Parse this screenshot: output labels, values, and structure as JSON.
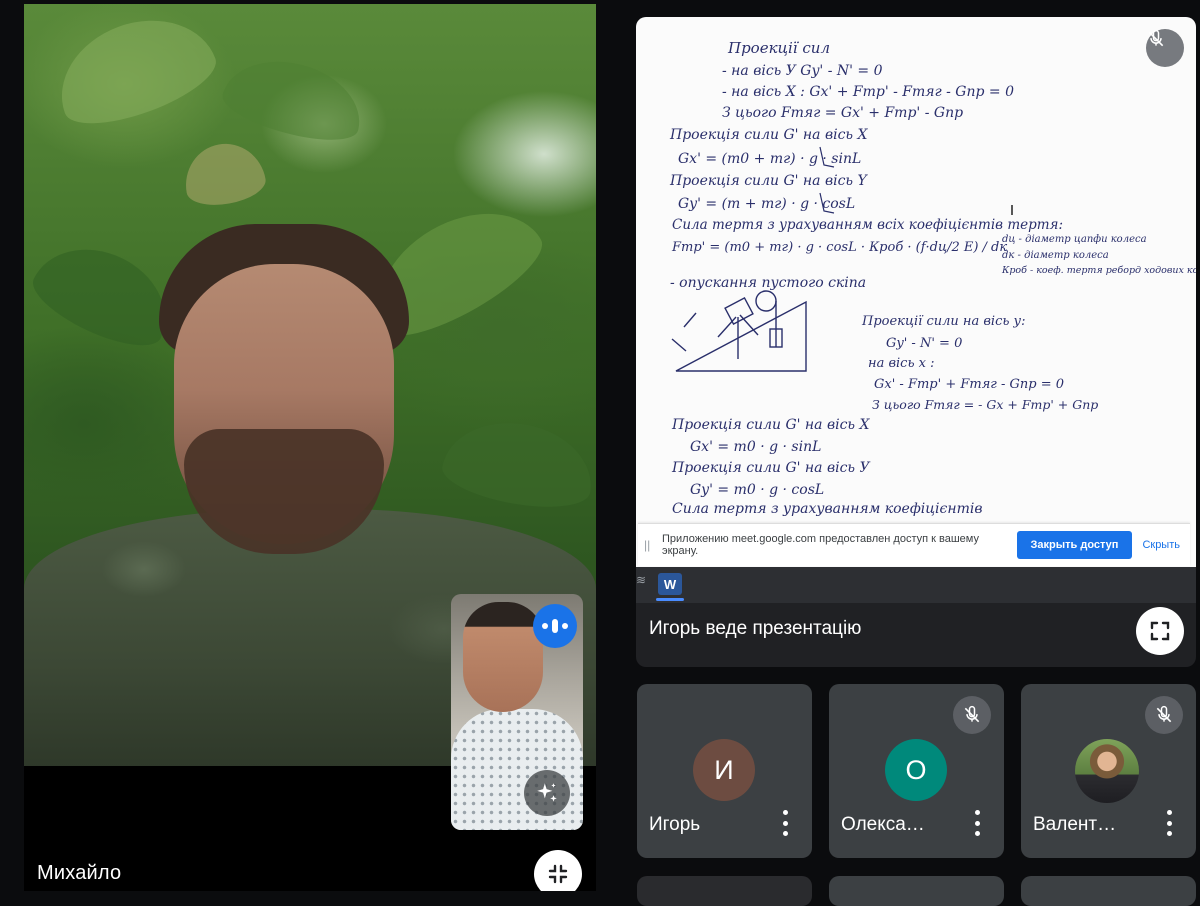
{
  "main_tile": {
    "participant_name": "Михайло"
  },
  "presentation": {
    "presenter_label": "Игорь веде презентацію",
    "share_bar": {
      "message": "Приложению meet.google.com предоставлен доступ к вашему экрану.",
      "stop_button": "Закрыть доступ",
      "hide_link": "Скрыть"
    },
    "taskbar": {
      "word_icon_letter": "W"
    },
    "handwritten_notes": [
      "Проекції сил",
      "- на вісь У   Gy' - N' = 0",
      "- на вісь Х :   Gx' + Fтр' - Fтяг - Gпр = 0",
      "З цього  Fтяг = Gx' + Fтр' - Gпр",
      "Проекція сили G' на вісь X",
      "Gx' = (m0 + mг) · g · sinL",
      "Проекція сили G' на вісь Y",
      "Gy' = (m + mг) · g · cosL",
      "Сила тертя з урахуванням всіх коефіцієнтів тертя:",
      "Fтр' = (m0 + mг) · g · cosL · Кроб · (f·dц/2 E) / dк",
      "dц - діаметр цапфи колеса",
      "dк - діаметр колеса",
      "Кроб - коеф. тертя реборд ходових коліс об рейки.",
      "- опускання пустого скіпа",
      "Проекції сили на вісь у:",
      "Gy' - N' = 0",
      "на вісь х :",
      "Gx' - Fтр' + Fтяг - Gпр = 0",
      "З цього Fтяг = - Gx + Fтр' + Gпр",
      "Проекція сили G' на вісь Х",
      "Gx' = m0 · g · sinL",
      "Проекція сили G' на вісь У",
      "Gy' = m0 · g · cosL",
      "Сила тертя з урахуванням коефіцієнтів"
    ]
  },
  "participants": [
    {
      "name": "Игорь",
      "initial": "И",
      "avatar_color": "#6d4c41",
      "muted": false
    },
    {
      "name": "Олекса…",
      "initial": "О",
      "avatar_color": "#00897b",
      "muted": true
    },
    {
      "name": "Валент…",
      "initial": "",
      "avatar_color": "",
      "muted": true
    }
  ],
  "colors": {
    "background": "#0b0c0e",
    "tile": "#3c4043",
    "accent": "#1a73e8"
  },
  "icons": {
    "main_collapse": "collapse-icon",
    "present_fullscreen": "fullscreen-icon",
    "speaking": "audio-levels-icon",
    "effects": "sparkle-icon",
    "mic_off": "mic-off-icon",
    "menu": "more-vert-icon"
  }
}
